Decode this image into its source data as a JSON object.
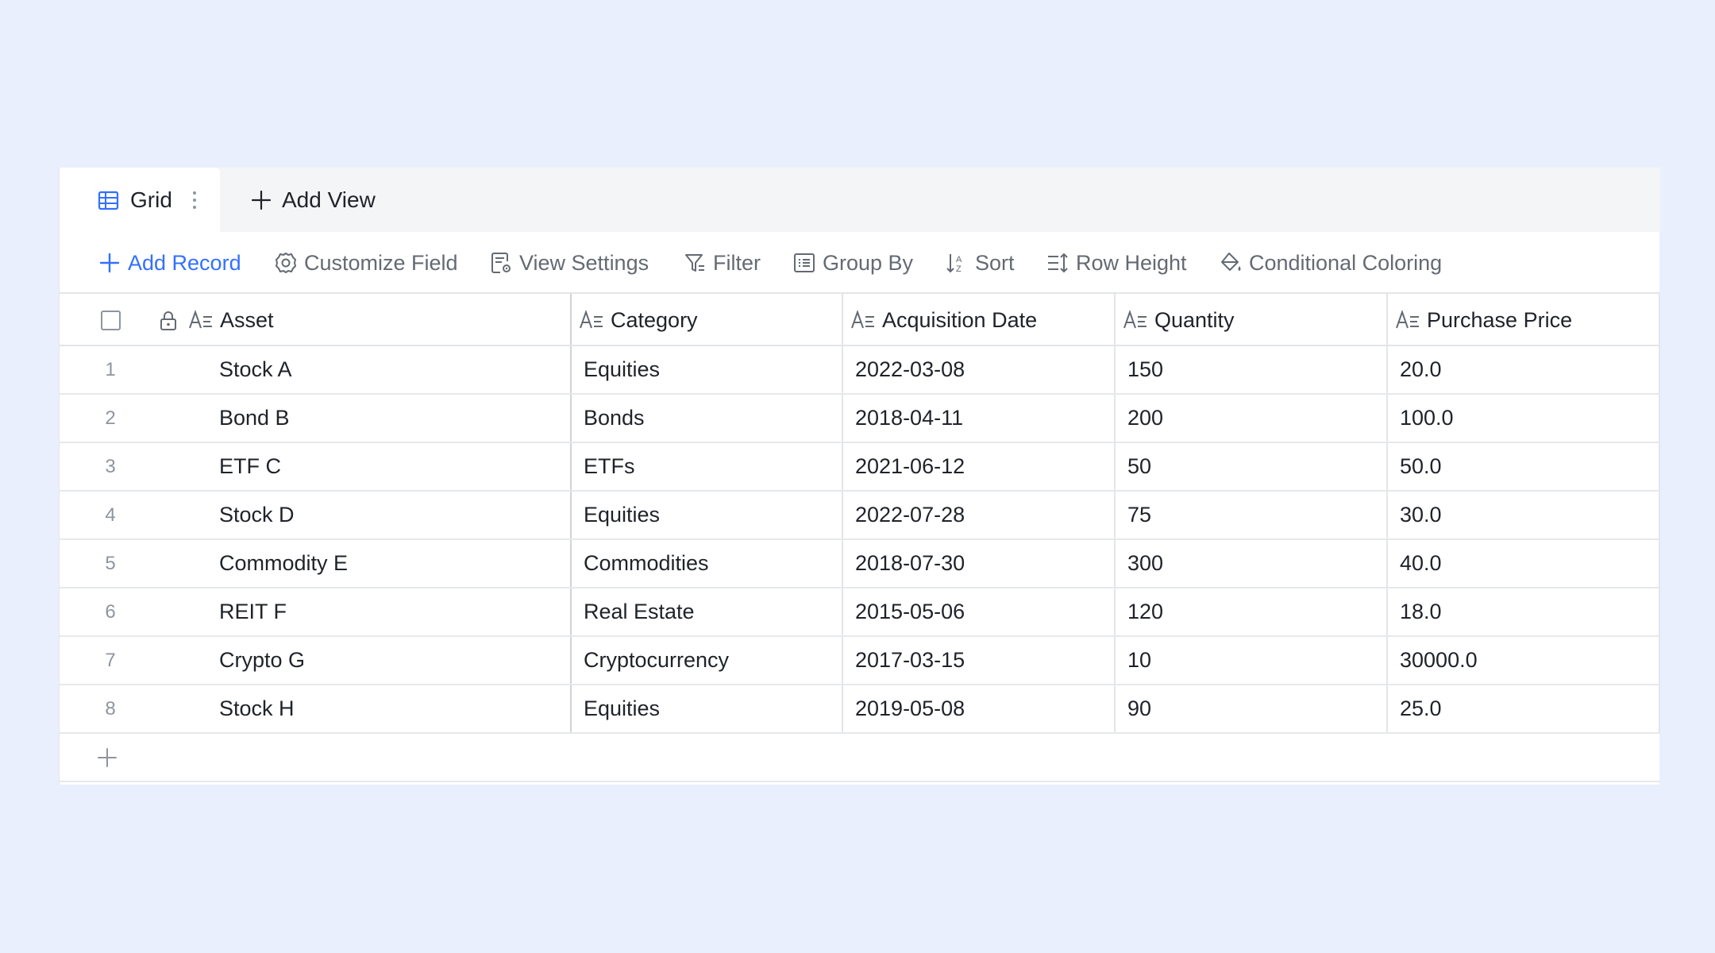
{
  "tabs": {
    "active_label": "Grid",
    "add_view_label": "Add View"
  },
  "toolbar": {
    "add_record": "Add Record",
    "customize_field": "Customize Field",
    "view_settings": "View Settings",
    "filter": "Filter",
    "group_by": "Group By",
    "sort": "Sort",
    "row_height": "Row Height",
    "conditional_coloring": "Conditional Coloring"
  },
  "columns": [
    "Asset",
    "Category",
    "Acquisition Date",
    "Quantity",
    "Purchase Price"
  ],
  "rows": [
    {
      "num": "1",
      "asset": "Stock A",
      "category": "Equities",
      "date": "2022-03-08",
      "quantity": "150",
      "price": "20.0"
    },
    {
      "num": "2",
      "asset": "Bond B",
      "category": "Bonds",
      "date": "2018-04-11",
      "quantity": "200",
      "price": "100.0"
    },
    {
      "num": "3",
      "asset": "ETF C",
      "category": "ETFs",
      "date": "2021-06-12",
      "quantity": "50",
      "price": "50.0"
    },
    {
      "num": "4",
      "asset": "Stock D",
      "category": "Equities",
      "date": "2022-07-28",
      "quantity": "75",
      "price": "30.0"
    },
    {
      "num": "5",
      "asset": "Commodity E",
      "category": "Commodities",
      "date": "2018-07-30",
      "quantity": "300",
      "price": "40.0"
    },
    {
      "num": "6",
      "asset": "REIT F",
      "category": "Real Estate",
      "date": "2015-05-06",
      "quantity": "120",
      "price": "18.0"
    },
    {
      "num": "7",
      "asset": "Crypto G",
      "category": "Cryptocurrency",
      "date": "2017-03-15",
      "quantity": "10",
      "price": "30000.0"
    },
    {
      "num": "8",
      "asset": "Stock H",
      "category": "Equities",
      "date": "2019-05-08",
      "quantity": "90",
      "price": "25.0"
    }
  ],
  "colors": {
    "background": "#E9EFFD",
    "accent": "#3370FF",
    "text": "#1F2329",
    "muted": "#646A73"
  },
  "icons": {
    "grid_tab": "grid-table-icon",
    "tab_more": "vertical-dots-icon",
    "add_view": "plus-icon",
    "add_record": "plus-icon",
    "customize_field": "gear-icon",
    "view_settings": "document-settings-icon",
    "filter": "funnel-icon",
    "group_by": "list-box-icon",
    "sort": "sort-az-icon",
    "row_height": "row-height-icon",
    "conditional_coloring": "paint-bucket-icon",
    "primary_field": "lock-icon",
    "text_field": "text-field-icon",
    "add_row": "plus-icon"
  }
}
